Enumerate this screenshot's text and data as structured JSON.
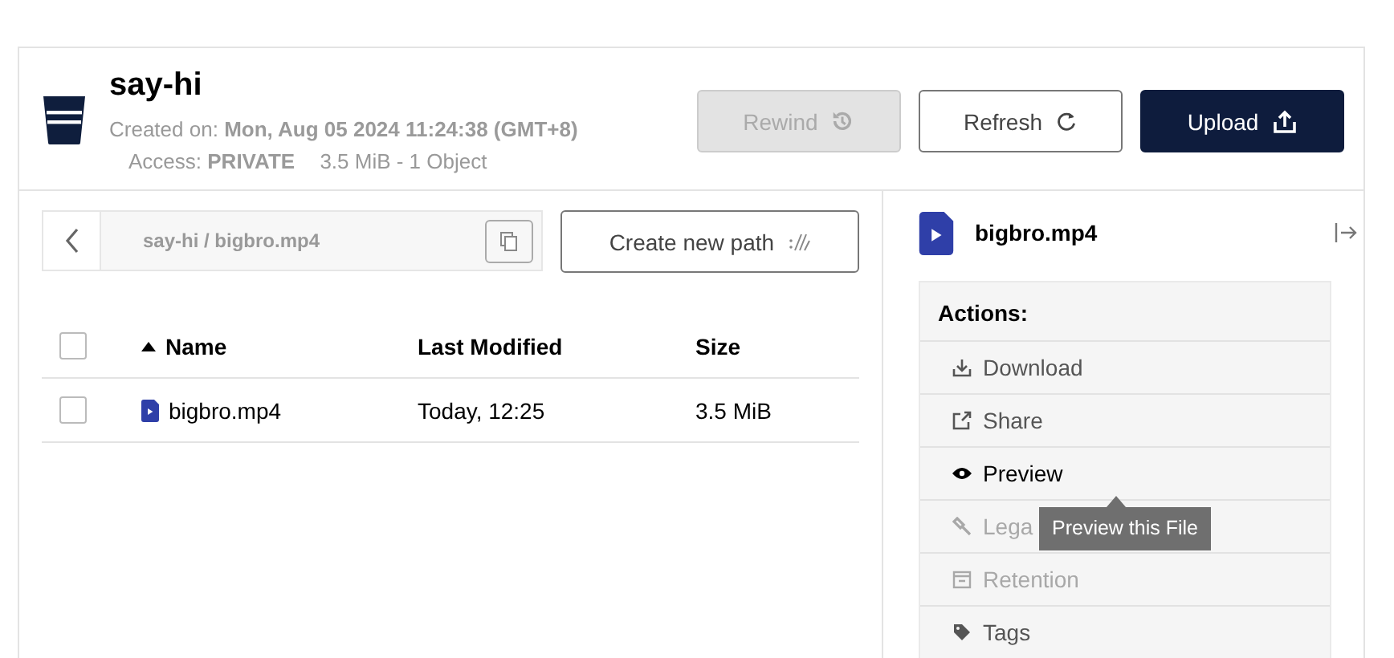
{
  "bucket": {
    "name": "say-hi",
    "created_label": "Created on:",
    "created_value": "Mon, Aug 05 2024 11:24:38 (GMT+8)",
    "access_label": "Access:",
    "access_value": "PRIVATE",
    "usage": "3.5 MiB - 1 Object"
  },
  "buttons": [
    {
      "label": "Rewind",
      "kind": "rewind",
      "disabled": true
    },
    {
      "label": "Refresh",
      "kind": "refresh",
      "disabled": false
    },
    {
      "label": "Upload",
      "kind": "upload",
      "disabled": false
    }
  ],
  "breadcrumb": {
    "path": "say-hi / bigbro.mp4"
  },
  "create_path_button": "Create new path",
  "table": {
    "columns": [
      {
        "label": "Name",
        "sorted": true
      },
      {
        "label": "Last Modified",
        "sorted": false
      },
      {
        "label": "Size",
        "sorted": false
      }
    ],
    "header_checked": false,
    "rows": [
      {
        "name": "bigbro.mp4",
        "modified": "Today, 12:25",
        "size": "3.5 MiB",
        "checked": false
      }
    ]
  },
  "details": {
    "file_name": "bigbro.mp4",
    "actions_title": "Actions:",
    "actions": [
      {
        "label": "Download",
        "kind": "download",
        "disabled": false,
        "hovered": false
      },
      {
        "label": "Share",
        "kind": "share",
        "disabled": false,
        "hovered": false
      },
      {
        "label": "Preview",
        "kind": "preview",
        "disabled": false,
        "hovered": true
      },
      {
        "label": "Lega",
        "kind": "legal",
        "disabled": true,
        "hovered": false
      },
      {
        "label": "Retention",
        "kind": "retention",
        "disabled": true,
        "hovered": false
      },
      {
        "label": "Tags",
        "kind": "tags",
        "disabled": false,
        "hovered": false
      }
    ],
    "tooltip": "Preview this File"
  }
}
